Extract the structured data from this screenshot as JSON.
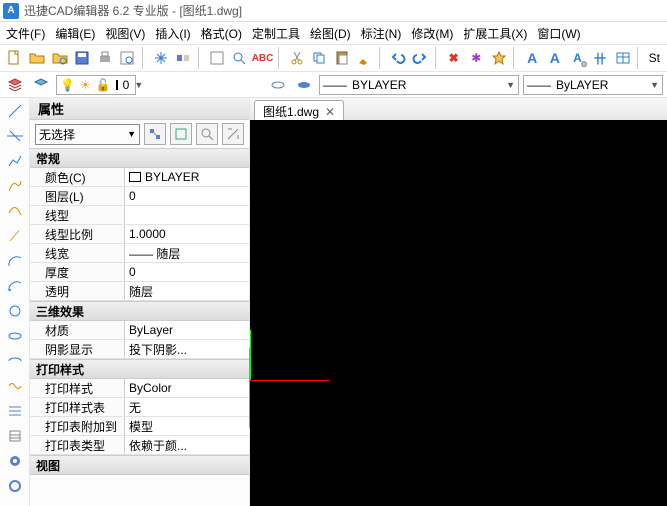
{
  "titlebar": {
    "text": "迅捷CAD编辑器 6.2 专业版  -  [图纸1.dwg]"
  },
  "menubar": [
    "文件(F)",
    "编辑(E)",
    "视图(V)",
    "插入(I)",
    "格式(O)",
    "定制工具",
    "绘图(D)",
    "标注(N)",
    "修改(M)",
    "扩展工具(X)",
    "窗口(W)"
  ],
  "layerbar": {
    "combo1": "0",
    "combo2_prefix": "——",
    "combo2": "BYLAYER",
    "combo3_prefix": "——",
    "combo3": "ByLAYER"
  },
  "style_label": "St",
  "tab": {
    "name": "图纸1.dwg"
  },
  "properties": {
    "title": "属性",
    "selection": "无选择",
    "sections": [
      {
        "title": "常规",
        "rows": [
          {
            "label": "颜色(C)",
            "value": "BYLAYER",
            "swatch": true
          },
          {
            "label": "图层(L)",
            "value": "0"
          },
          {
            "label": "线型",
            "value": ""
          },
          {
            "label": "线型比例",
            "value": "1.0000"
          },
          {
            "label": "线宽",
            "value": "—— 随层"
          },
          {
            "label": "厚度",
            "value": "0"
          },
          {
            "label": "透明",
            "value": "随层"
          }
        ]
      },
      {
        "title": "三维效果",
        "rows": [
          {
            "label": "材质",
            "value": "ByLayer"
          },
          {
            "label": "阴影显示",
            "value": "投下阴影..."
          }
        ]
      },
      {
        "title": "打印样式",
        "rows": [
          {
            "label": "打印样式",
            "value": "ByColor"
          },
          {
            "label": "打印样式表",
            "value": "无"
          },
          {
            "label": "打印表附加到",
            "value": "模型"
          },
          {
            "label": "打印表类型",
            "value": "依赖于颜..."
          }
        ]
      },
      {
        "title": "视图",
        "rows": []
      }
    ]
  },
  "colors": {
    "accent_blue": "#2b7dd6",
    "toolbar_border": "#e5e5e5"
  },
  "text_icons": {
    "letter_A": "A",
    "kanji_dim": "卄",
    "sun": "☀",
    "bulb": "💡"
  }
}
